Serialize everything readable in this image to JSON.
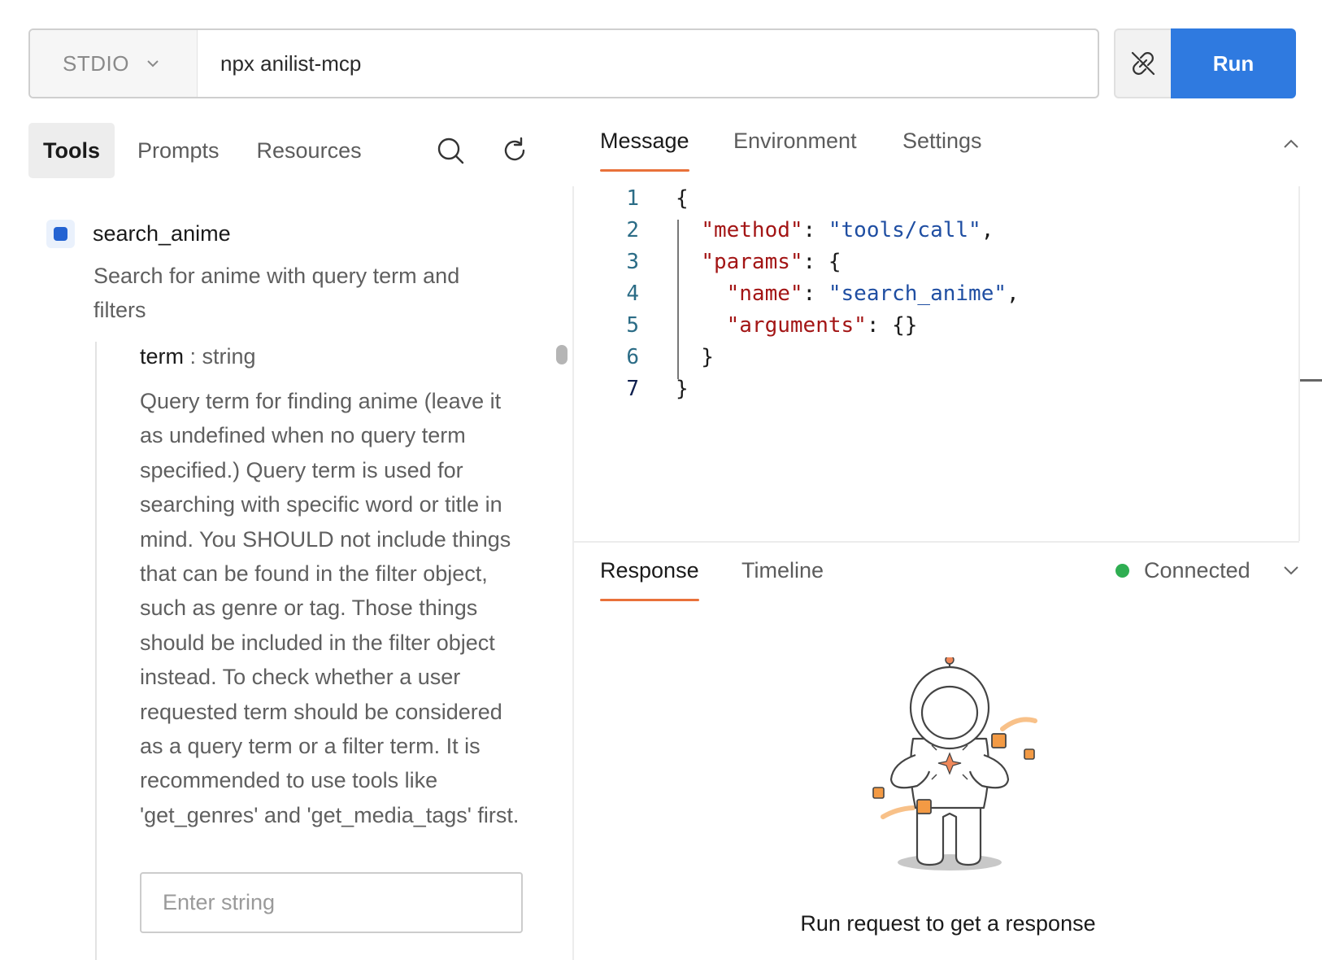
{
  "connection": {
    "transport": "STDIO",
    "command": "npx anilist-mcp",
    "run_label": "Run"
  },
  "sidebar": {
    "tabs": [
      {
        "label": "Tools",
        "active": true
      },
      {
        "label": "Prompts",
        "active": false
      },
      {
        "label": "Resources",
        "active": false
      }
    ],
    "tool": {
      "name": "search_anime",
      "description": "Search for anime with query term and filters",
      "param": {
        "name": "term",
        "separator": " : ",
        "type": "string",
        "description": "Query term for finding anime (leave it as undefined when no query term specified.) Query term is used for searching with specific word or title in mind. You SHOULD not include things that can be found in the filter object, such as genre or tag. Those things should be included in the filter object instead. To check whether a user requested term should be considered as a query term or a filter term. It is recommended to use tools like 'get_genres' and 'get_media_tags' first.",
        "placeholder": "Enter string"
      }
    }
  },
  "request": {
    "tabs": [
      {
        "label": "Message",
        "active": true
      },
      {
        "label": "Environment",
        "active": false
      },
      {
        "label": "Settings",
        "active": false
      }
    ],
    "code_lines": [
      "1",
      "2",
      "3",
      "4",
      "5",
      "6",
      "7"
    ],
    "json_message": {
      "method_key": "\"method\"",
      "method_value": "\"tools/call\"",
      "params_key": "\"params\"",
      "name_key": "\"name\"",
      "name_value": "\"search_anime\"",
      "arguments_key": "\"arguments\""
    }
  },
  "response": {
    "tabs": [
      {
        "label": "Response",
        "active": true
      },
      {
        "label": "Timeline",
        "active": false
      }
    ],
    "status": "Connected",
    "status_color": "#2fae52",
    "empty_message": "Run request to get a response"
  },
  "colors": {
    "accent": "#2f7ae0",
    "tab_underline": "#e9713a"
  }
}
